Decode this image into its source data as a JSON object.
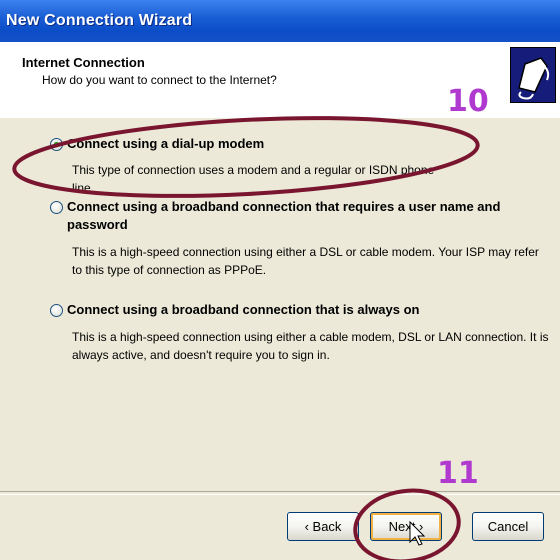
{
  "window": {
    "title": "New Connection Wizard"
  },
  "header": {
    "title": "Internet Connection",
    "subtitle": "How do you want to connect to the Internet?"
  },
  "options": [
    {
      "label": "Connect using a dial-up modem",
      "description": "This type of connection uses a modem and a regular or ISDN phone line.",
      "selected": true
    },
    {
      "label_line1": "Connect using a broadband connection that requires a user name and",
      "label_line2": "password",
      "description_line1": "This is a high-speed connection using either a DSL or cable modem. Your ISP may refer",
      "description_line2": "to this type of connection as PPPoE.",
      "selected": false
    },
    {
      "label": "Connect using a broadband connection that is always on",
      "description_line1": "This is a high-speed connection using either a cable modem, DSL or LAN connection. It is",
      "description_line2": "always active, and doesn't require you to sign in.",
      "selected": false
    }
  ],
  "annotations": {
    "step_a": "10",
    "step_b": "11",
    "color": "#b03ad0",
    "ellipse_color": "#7a1530"
  },
  "buttons": {
    "back": "‹ Back",
    "next": "Next ›",
    "cancel": "Cancel"
  }
}
